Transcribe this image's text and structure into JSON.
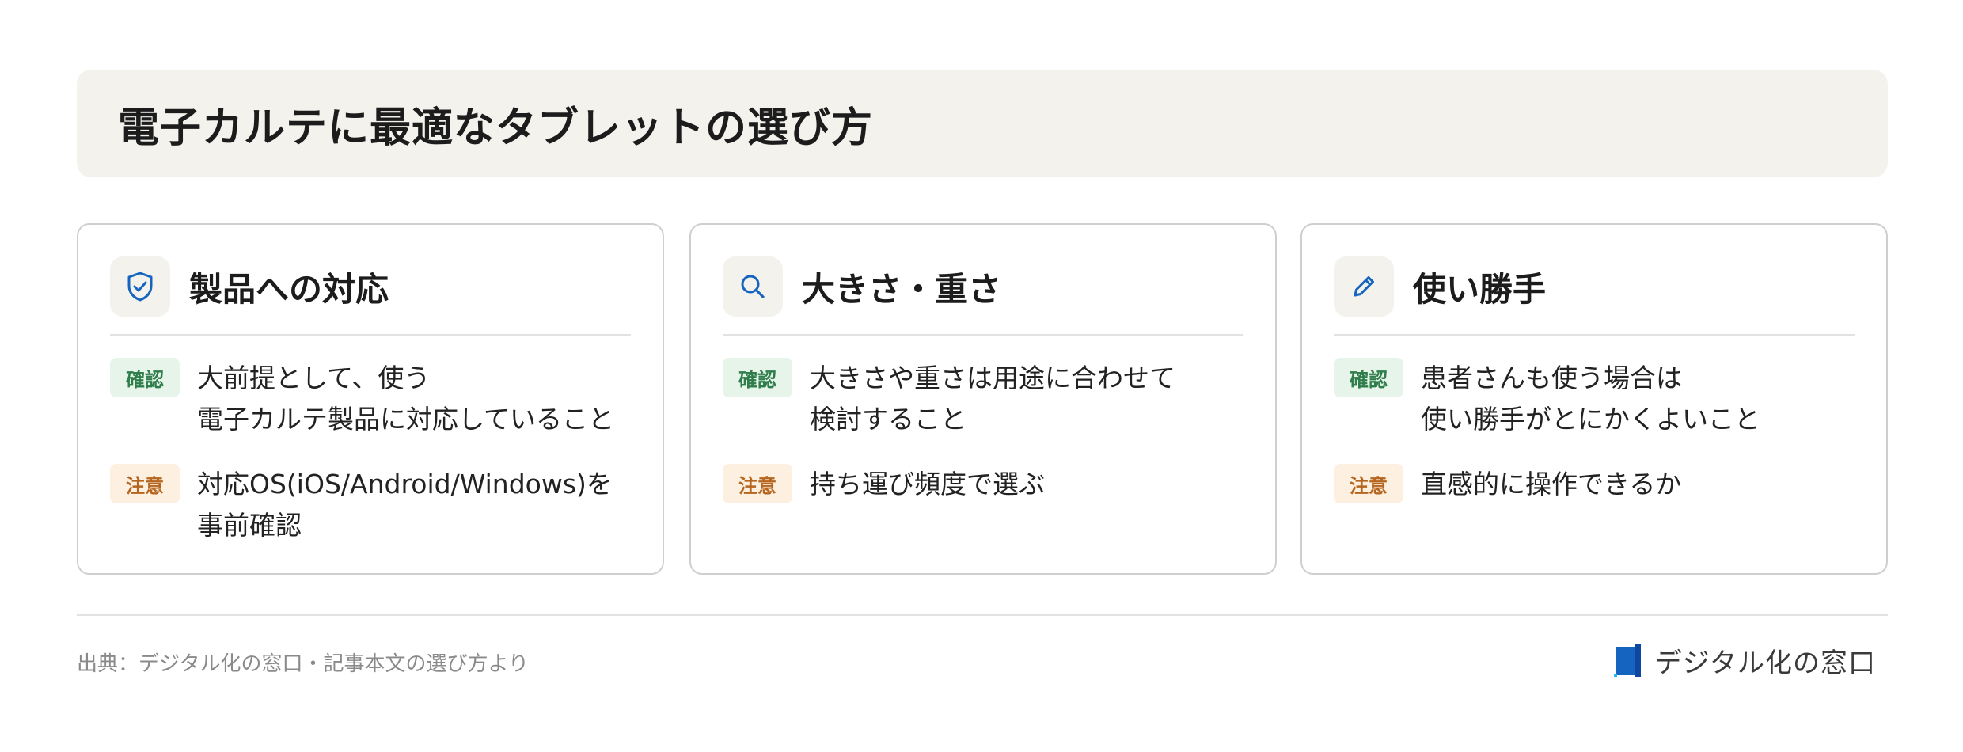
{
  "title": "電子カルテに最適なタブレットの選び方",
  "cards": [
    {
      "icon": "shield-check-icon",
      "title": "製品への対応",
      "rows": [
        {
          "badge": "確認",
          "type": "confirm",
          "text": "大前提として、使う\n電子カルテ製品に対応していること"
        },
        {
          "badge": "注意",
          "type": "caution",
          "text": "対応OS(iOS/Android/Windows)を\n事前確認"
        }
      ]
    },
    {
      "icon": "search-icon",
      "title": "大きさ・重さ",
      "rows": [
        {
          "badge": "確認",
          "type": "confirm",
          "text": "大きさや重さは用途に合わせて\n検討すること"
        },
        {
          "badge": "注意",
          "type": "caution",
          "text": "持ち運び頻度で選ぶ"
        }
      ]
    },
    {
      "icon": "pencil-icon",
      "title": "使い勝手",
      "rows": [
        {
          "badge": "確認",
          "type": "confirm",
          "text": "患者さんも使う場合は\n使い勝手がとにかくよいこと"
        },
        {
          "badge": "注意",
          "type": "caution",
          "text": "直感的に操作できるか"
        }
      ]
    }
  ],
  "footer": {
    "source": "出典：デジタル化の窓口・記事本文の選び方より",
    "brand": "デジタル化の窓口"
  },
  "colors": {
    "accent_blue": "#1565c0",
    "confirm_green": "#2e7d4a",
    "caution_orange": "#b5651d"
  }
}
